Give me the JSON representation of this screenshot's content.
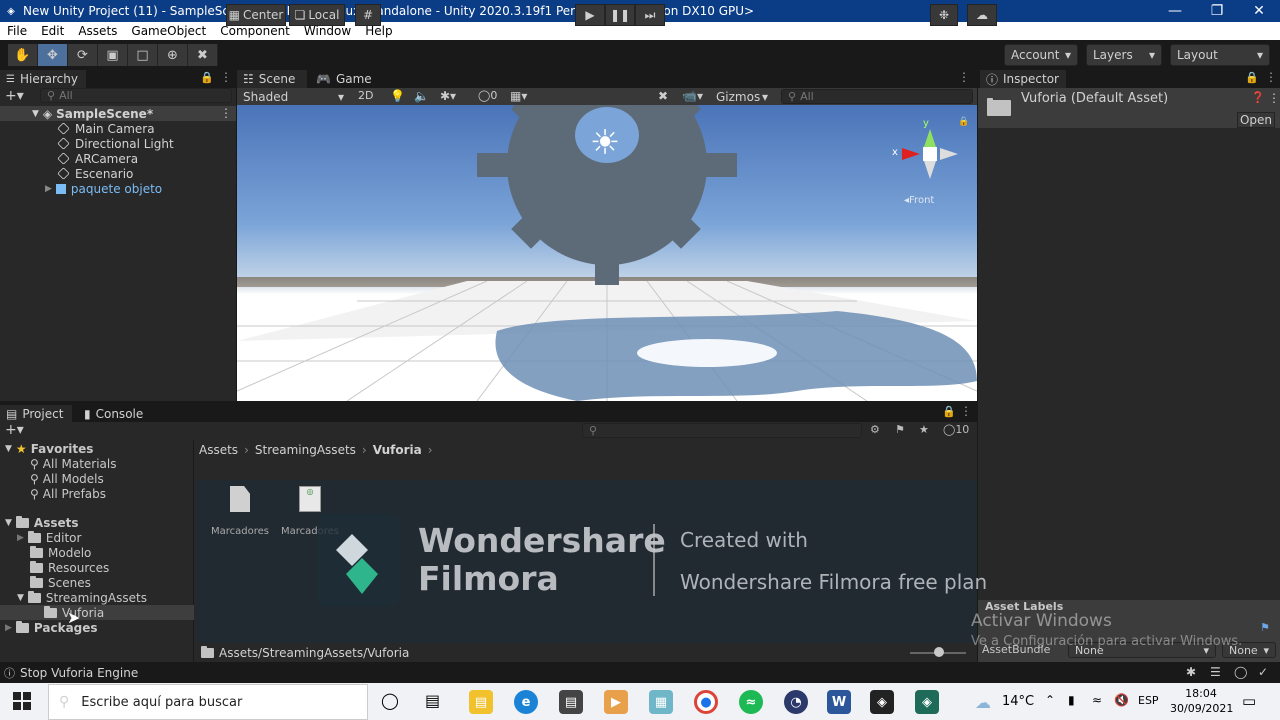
{
  "window": {
    "title": "New Unity Project (11) - SampleScene - PC, Mac & Linux Standalone - Unity 2020.3.19f1 Personal* <DX11 on DX10 GPU>",
    "controls": [
      "—",
      "❐",
      "✕"
    ]
  },
  "menu": [
    "File",
    "Edit",
    "Assets",
    "GameObject",
    "Component",
    "Window",
    "Help"
  ],
  "toolbar": {
    "pivot_label": "Center",
    "space_label": "Local",
    "account_label": "Account",
    "layers_label": "Layers",
    "layout_label": "Layout"
  },
  "hierarchy": {
    "tab_label": "Hierarchy",
    "search_placeholder": "All",
    "scene_name": "SampleScene*",
    "items": [
      "Main Camera",
      "Directional Light",
      "ARCamera",
      "Escenario",
      "paquete objeto"
    ]
  },
  "scene": {
    "tabs": [
      "Scene",
      "Game"
    ],
    "shading_mode": "Shaded",
    "mode_2d": "2D",
    "hidden_count": "0",
    "gizmos_label": "Gizmos",
    "search_placeholder": "All",
    "gizmo_axes": {
      "y": "y",
      "x": "x"
    },
    "gizmo_view_label": "Front"
  },
  "inspector": {
    "tab_label": "Inspector",
    "asset_title": "Vuforia (Default Asset)",
    "open_button": "Open",
    "asset_labels_header": "Asset Labels",
    "assetbundle_label": "AssetBundle",
    "assetbundle_value": "None",
    "assetbundle_variant": "None"
  },
  "project": {
    "tabs": [
      "Project",
      "Console"
    ],
    "hidden_count": "10",
    "favorites_label": "Favorites",
    "favorites": [
      "All Materials",
      "All Models",
      "All Prefabs"
    ],
    "assets_label": "Assets",
    "asset_folders": [
      "Editor",
      "Modelo",
      "Resources",
      "Scenes",
      "StreamingAssets"
    ],
    "sub_folder": "Vuforia",
    "packages_label": "Packages",
    "breadcrumb": [
      "Assets",
      "StreamingAssets",
      "Vuforia"
    ],
    "files": [
      "Marcadores",
      "Marcadores"
    ],
    "path": "Assets/StreamingAssets/Vuforia"
  },
  "watermark": {
    "brand_line1": "Wondershare",
    "brand_line2": "Filmora",
    "created_with": "Created with",
    "plan": "Wondershare Filmora free plan"
  },
  "activation": {
    "title": "Activar Windows",
    "subtitle": "Ve a Configuración para activar Windows."
  },
  "status_bar": {
    "message": "Stop Vuforia Engine"
  },
  "taskbar": {
    "search_placeholder": "Escribe aquí para buscar",
    "temperature": "14°C",
    "language": "ESP",
    "time": "18:04",
    "date": "30/09/2021"
  },
  "colors": {
    "title_bar": "#0b3c86",
    "selected_blue": "#4d6f9c",
    "prefab_blue": "#7bbcf5",
    "sky_top": "#4a74b8",
    "gear": "#5d6b78"
  }
}
